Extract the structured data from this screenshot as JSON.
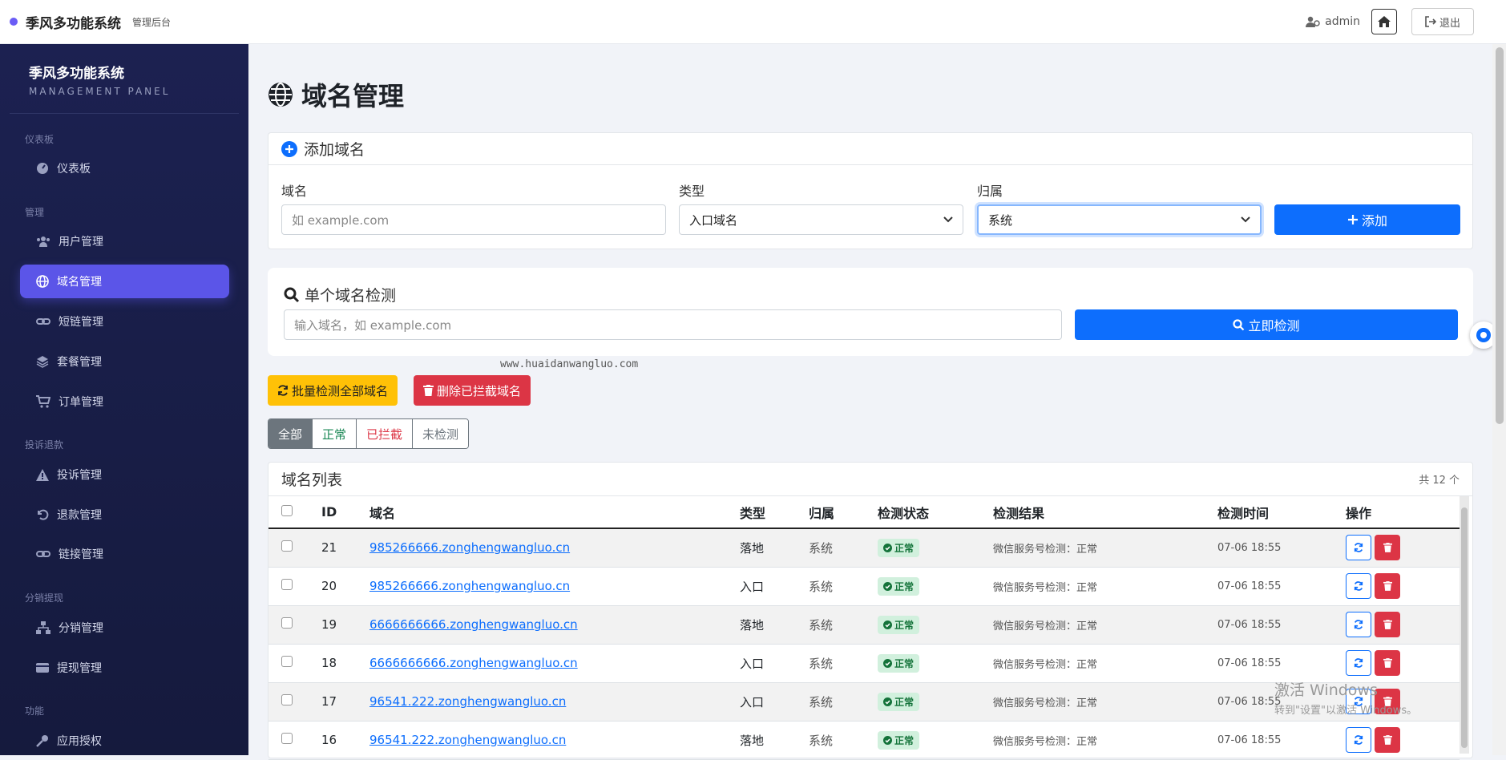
{
  "topbar": {
    "brand": "季风多功能系统",
    "sub": "管理后台",
    "user": "admin",
    "logout": "退出"
  },
  "sidebar": {
    "title": "季风多功能系统",
    "subtitle": "MANAGEMENT PANEL",
    "sections": [
      "仪表板",
      "管理",
      "投诉退款",
      "分销提现",
      "功能"
    ],
    "items": [
      "仪表板",
      "用户管理",
      "域名管理",
      "短链管理",
      "套餐管理",
      "订单管理",
      "投诉管理",
      "退款管理",
      "链接管理",
      "分销管理",
      "提现管理",
      "应用授权"
    ]
  },
  "page": {
    "title": "域名管理"
  },
  "add_card": {
    "title": "添加域名",
    "domain_label": "域名",
    "domain_placeholder": "如 example.com",
    "type_label": "类型",
    "type_value": "入口域名",
    "owner_label": "归属",
    "owner_value": "系统",
    "add_button": "添加"
  },
  "check_card": {
    "title": "单个域名检测",
    "placeholder": "输入域名，如 example.com",
    "button": "立即检测"
  },
  "watermark": "www.huaidanwangluo.com",
  "actions": {
    "batch_check": "批量检测全部域名",
    "delete_blocked": "删除已拦截域名"
  },
  "filters": [
    "全部",
    "正常",
    "已拦截",
    "未检测"
  ],
  "list": {
    "title": "域名列表",
    "count": "共 12 个",
    "columns": [
      "ID",
      "域名",
      "类型",
      "归属",
      "检测状态",
      "检测结果",
      "检测时间",
      "操作"
    ],
    "rows": [
      {
        "id": "21",
        "domain": "985266666.zonghengwangluo.cn",
        "type": "落地",
        "owner": "系统",
        "status": "正常",
        "result": "微信服务号检测：正常",
        "time": "07-06 18:55"
      },
      {
        "id": "20",
        "domain": "985266666.zonghengwangluo.cn",
        "type": "入口",
        "owner": "系统",
        "status": "正常",
        "result": "微信服务号检测：正常",
        "time": "07-06 18:55"
      },
      {
        "id": "19",
        "domain": "6666666666.zonghengwangluo.cn",
        "type": "落地",
        "owner": "系统",
        "status": "正常",
        "result": "微信服务号检测：正常",
        "time": "07-06 18:55"
      },
      {
        "id": "18",
        "domain": "6666666666.zonghengwangluo.cn",
        "type": "入口",
        "owner": "系统",
        "status": "正常",
        "result": "微信服务号检测：正常",
        "time": "07-06 18:55"
      },
      {
        "id": "17",
        "domain": "96541.222.zonghengwangluo.cn",
        "type": "入口",
        "owner": "系统",
        "status": "正常",
        "result": "微信服务号检测：正常",
        "time": "07-06 18:55"
      },
      {
        "id": "16",
        "domain": "96541.222.zonghengwangluo.cn",
        "type": "落地",
        "owner": "系统",
        "status": "正常",
        "result": "微信服务号检测：正常",
        "time": "07-06 18:55"
      }
    ]
  },
  "windows_watermark": {
    "line1": "激活 Windows",
    "line2": "转到\"设置\"以激活 Windows。"
  },
  "colors": {
    "accent": "#5b55e8",
    "primary": "#0d6efd",
    "warning": "#ffc107",
    "danger": "#dc3545",
    "sidebar": "#1c2151"
  }
}
